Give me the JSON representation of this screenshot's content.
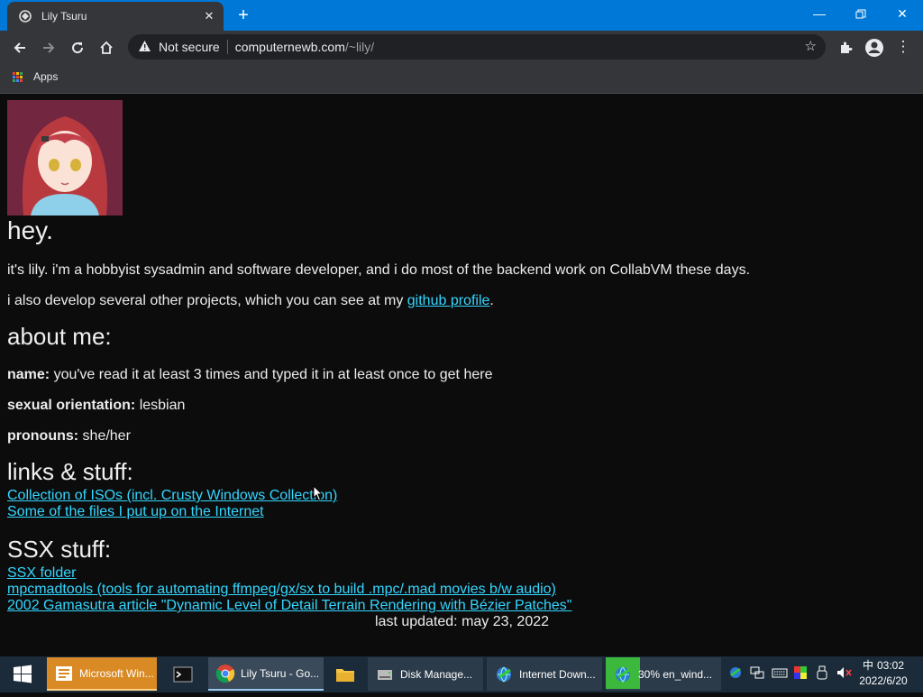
{
  "browser": {
    "tab_title": "Lily Tsuru",
    "new_tab_symbol": "+",
    "not_secure": "Not secure",
    "url_host": "computernewb.com",
    "url_path": "/~lily/",
    "bookmarks_apps": "Apps"
  },
  "page": {
    "greeting": "hey.",
    "intro": "it's lily. i'm a hobbyist sysadmin and software developer, and i do most of the backend work on CollabVM these days.",
    "projects_before": "i also develop several other projects, which you can see at my ",
    "projects_link": "github profile",
    "projects_after": ".",
    "about_heading": "about me:",
    "about": [
      {
        "label": "name:",
        "value": " you've read it at least 3 times and typed it in at least once to get here"
      },
      {
        "label": "sexual orientation:",
        "value": " lesbian"
      },
      {
        "label": "pronouns:",
        "value": " she/her"
      }
    ],
    "links_heading": "links & stuff:",
    "links": [
      "Collection of ISOs (incl. Crusty Windows Collection)",
      "Some of the files I put up on the Internet"
    ],
    "ssx_heading": "SSX stuff:",
    "ssx_links": [
      "SSX folder",
      "mpcmadtools (tools for automating ffmpeg/gx/sx to build .mpc/.mad movies b/w audio)",
      "2002 Gamasutra article \"Dynamic Level of Detail Terrain Rendering with Bézier Patches\""
    ],
    "last_updated": "last updated: may 23, 2022"
  },
  "taskbar": {
    "items": [
      "Microsoft Win...",
      "",
      "Lily Tsuru - Go...",
      "",
      "Disk Manage...",
      "Internet Down...",
      "30% en_wind..."
    ],
    "tray_lang": "中",
    "time": "03:02",
    "date": "2022/6/20"
  },
  "colors": {
    "link": "#33d6ff",
    "title_bar": "#0078d7",
    "page_bg": "#0c0c0c",
    "taskbar": "#1b2b3a"
  }
}
